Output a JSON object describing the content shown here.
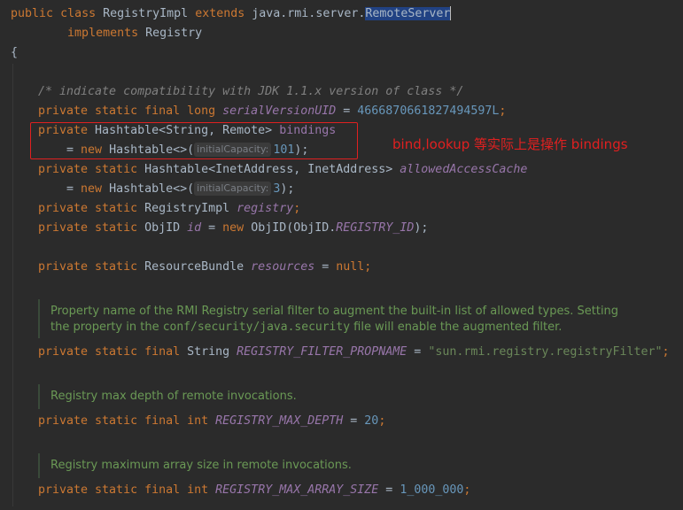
{
  "code": {
    "l1": {
      "kw_public": "public",
      "kw_class": "class",
      "name": "RegistryImpl",
      "kw_extends": "extends",
      "pkg": "java.rmi.server.",
      "super": "RemoteServer"
    },
    "l2": {
      "kw_implements": "implements",
      "iface": "Registry"
    },
    "l3": "{",
    "l5": "/* indicate compatibility with JDK 1.1.x version of class */",
    "l6": {
      "mods": "private static final long",
      "field": "serialVersionUID",
      "eq": " = ",
      "val": "4666870661827494597L",
      "end": ";"
    },
    "l7": {
      "mods": "private",
      "type": " Hashtable<String, Remote> ",
      "field": "bindings"
    },
    "l8": {
      "eq": "= ",
      "kw_new": "new",
      "ctor": " Hashtable<>(",
      "hint": "initialCapacity:",
      "val": "101",
      "end": ");"
    },
    "l9": {
      "mods": "private static",
      "type": " Hashtable<InetAddress, InetAddress> ",
      "field": "allowedAccessCache"
    },
    "l10": {
      "eq": "= ",
      "kw_new": "new",
      "ctor": " Hashtable<>(",
      "hint": "initialCapacity:",
      "val": "3",
      "end": ");"
    },
    "l11": {
      "mods": "private static",
      "type": " RegistryImpl ",
      "field": "registry",
      "end": ";"
    },
    "l12": {
      "mods": "private static",
      "type": " ObjID ",
      "field": "id",
      "eq": " = ",
      "kw_new": "new",
      "ctor": " ObjID(ObjID.",
      "const": "REGISTRY_ID",
      "end": ");"
    },
    "l14": {
      "mods": "private static",
      "type": " ResourceBundle ",
      "field": "resources",
      "eq": " = ",
      "null": "null",
      "end": ";"
    },
    "l17": {
      "mods": "private static final",
      "type": " String ",
      "field": "REGISTRY_FILTER_PROPNAME",
      "eq": " = ",
      "str": "\"sun.rmi.registry.registryFilter\"",
      "end": ";"
    },
    "l19": {
      "mods": "private static final int",
      "field": "REGISTRY_MAX_DEPTH",
      "eq": " = ",
      "val": "20",
      "end": ";"
    },
    "l21": {
      "mods": "private static final int",
      "field": "REGISTRY_MAX_ARRAY_SIZE",
      "eq": " = ",
      "val": "1_000_000",
      "end": ";"
    }
  },
  "docs": {
    "d1_line1": "Property name of the RMI Registry serial filter to augment the built-in list of allowed types. Setting",
    "d1_line2a": "the property in the ",
    "d1_code": "conf/security/java.security",
    "d1_line2b": " file will enable the augmented filter.",
    "d2": "Registry max depth of remote invocations.",
    "d3": "Registry maximum array size in remote invocations."
  },
  "annotation": "bind,lookup 等实际上是操作 bindings",
  "colors": {
    "keyword": "#cc7832",
    "field": "#9876aa",
    "number": "#6897bb",
    "string": "#6a8759",
    "annotation": "#e02020"
  }
}
